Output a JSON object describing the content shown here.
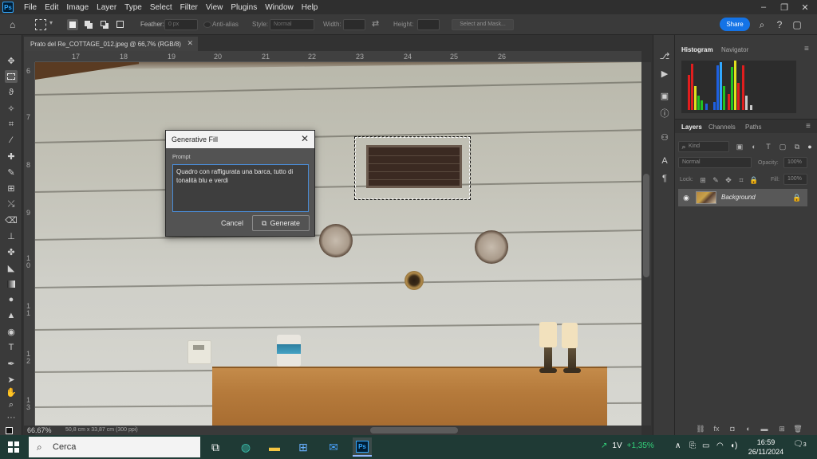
{
  "app": {
    "logo": "Ps"
  },
  "menu": [
    "File",
    "Edit",
    "Image",
    "Layer",
    "Type",
    "Select",
    "Filter",
    "View",
    "Plugins",
    "Window",
    "Help"
  ],
  "options": {
    "feather_label": "Feather:",
    "feather_value": "0 px",
    "antialias_label": "Anti-alias",
    "style_label": "Style:",
    "style_value": "Normal",
    "width_label": "Width:",
    "height_label": "Height:",
    "select_mask_label": "Select and Mask...",
    "share_label": "Share"
  },
  "document": {
    "tab_title": "Prato del Re_COTTAGE_012.jpeg @ 66,7% (RGB/8)",
    "zoom": "66.67%",
    "size_info": "50,8 cm x 33,87 cm (300 ppi)"
  },
  "rulers": {
    "top": [
      "17",
      "18",
      "19",
      "20",
      "21",
      "22",
      "23",
      "24",
      "25",
      "26"
    ],
    "left": [
      "6",
      "7",
      "8",
      "9",
      "1\n0",
      "1\n1",
      "1\n2",
      "1\n3"
    ]
  },
  "dialog": {
    "title": "Generative Fill",
    "prompt_label": "Prompt",
    "prompt_text": "Quadro con raffigurata una barca, tutto di tonalità blu e verdi",
    "cancel_label": "Cancel",
    "generate_label": "Generate"
  },
  "panels": {
    "top_tabs": [
      "Histogram",
      "Navigator"
    ],
    "layer_tabs": [
      "Layers",
      "Channels",
      "Paths"
    ],
    "kind_placeholder": "Kind",
    "blend_mode": "Normal",
    "opacity_label": "Opacity:",
    "opacity_value": "100%",
    "lock_label": "Lock:",
    "fill_label": "Fill:",
    "fill_value": "100%",
    "layer_name": "Background"
  },
  "taskbar": {
    "search_placeholder": "Cerca",
    "stock_name": "1V",
    "stock_change": "+1,35%",
    "time": "16:59",
    "date": "26/11/2024",
    "notification_count": "3"
  },
  "colors": {
    "accent_blue": "#1473e6",
    "panel_bg": "#3a3a3a",
    "app_bg": "#323232"
  }
}
